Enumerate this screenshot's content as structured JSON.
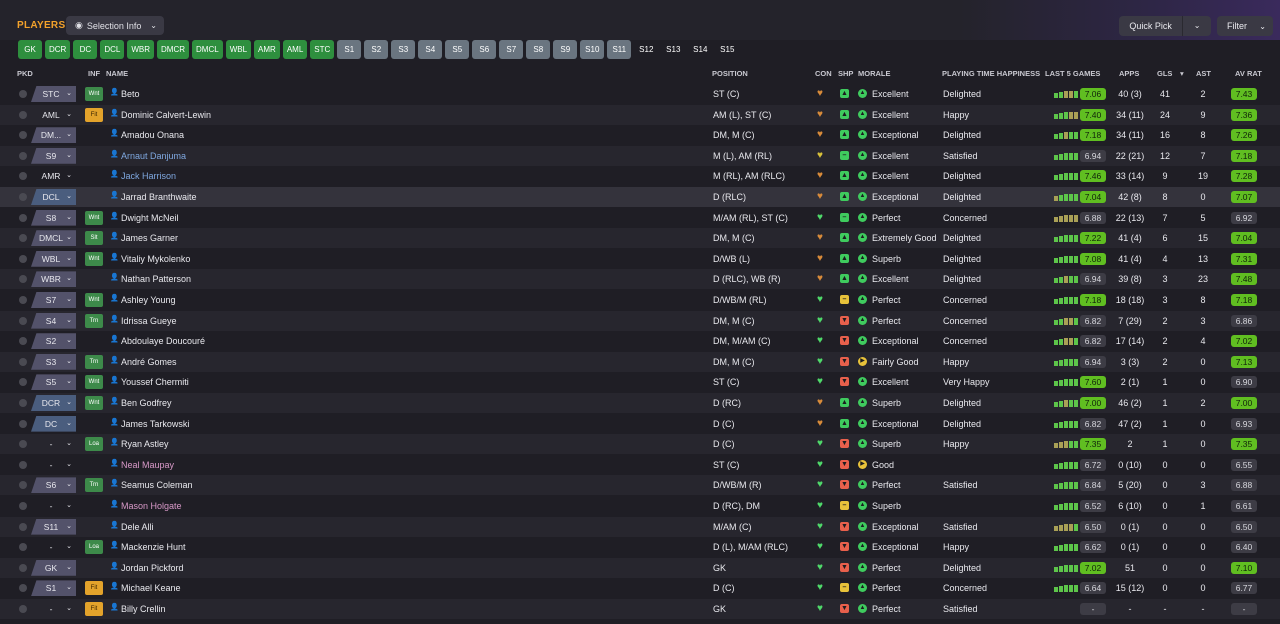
{
  "header": {
    "title": "PLAYERS",
    "selection_info": "Selection Info",
    "quick_pick": "Quick Pick",
    "filter": "Filter"
  },
  "positions": [
    {
      "label": "GK",
      "style": "g"
    },
    {
      "label": "DCR",
      "style": "g"
    },
    {
      "label": "DC",
      "style": "g"
    },
    {
      "label": "DCL",
      "style": "g"
    },
    {
      "label": "WBR",
      "style": "g"
    },
    {
      "label": "DMCR",
      "style": "g"
    },
    {
      "label": "DMCL",
      "style": "g"
    },
    {
      "label": "WBL",
      "style": "g"
    },
    {
      "label": "AMR",
      "style": "g"
    },
    {
      "label": "AML",
      "style": "g"
    },
    {
      "label": "STC",
      "style": "g"
    },
    {
      "label": "S1",
      "style": "s"
    },
    {
      "label": "S2",
      "style": "s"
    },
    {
      "label": "S3",
      "style": "s"
    },
    {
      "label": "S4",
      "style": "s"
    },
    {
      "label": "S5",
      "style": "s"
    },
    {
      "label": "S6",
      "style": "s"
    },
    {
      "label": "S7",
      "style": "s"
    },
    {
      "label": "S8",
      "style": "s"
    },
    {
      "label": "S9",
      "style": "s"
    },
    {
      "label": "S10",
      "style": "s"
    },
    {
      "label": "S11",
      "style": "s"
    },
    {
      "label": "S12",
      "style": "d"
    },
    {
      "label": "S13",
      "style": "d"
    },
    {
      "label": "S14",
      "style": "d"
    },
    {
      "label": "S15",
      "style": "d"
    }
  ],
  "columns": {
    "pkd": "PKD",
    "inf": "INF",
    "name": "NAME",
    "position": "POSITION",
    "con": "CON",
    "shp": "SHP",
    "morale": "MORALE",
    "pth": "PLAYING TIME HAPPINESS",
    "last5": "LAST 5 GAMES",
    "apps": "APPS",
    "gls": "GLS",
    "ast": "AST",
    "avrat": "AV RAT"
  },
  "colors": {
    "accent": "#f3a22b",
    "green_badge": "#60be21",
    "pos_green": "#2e8f3e",
    "pos_grey": "#6a7580"
  },
  "players": [
    {
      "role": "STC",
      "role_style": "p",
      "inf": "Wnt",
      "inf_style": "g",
      "name": "Beto",
      "name_color": "#e9e9ee",
      "position": "ST (C)",
      "con": "sad",
      "shp": "up",
      "mor": "up",
      "morale": "Excellent",
      "pth": "Delighted",
      "bars": [
        1,
        1,
        0,
        0,
        1
      ],
      "last5": "7.06",
      "last5_hi": true,
      "apps": "40 (3)",
      "gls": "41",
      "ast": "2",
      "avrat": "7.43",
      "av_hi": true
    },
    {
      "role": "AML",
      "role_style": "none",
      "inf": "Fit",
      "inf_style": "o",
      "name": "Dominic Calvert-Lewin",
      "name_color": "#e9e9ee",
      "position": "AM (L), ST (C)",
      "con": "sad",
      "shp": "up",
      "mor": "up",
      "morale": "Excellent",
      "pth": "Happy",
      "bars": [
        1,
        1,
        1,
        0,
        0
      ],
      "last5": "7.40",
      "last5_hi": true,
      "apps": "34 (11)",
      "gls": "24",
      "ast": "9",
      "avrat": "7.36",
      "av_hi": true
    },
    {
      "role": "DM...",
      "role_style": "p",
      "inf": "",
      "inf_style": "",
      "name": "Amadou Onana",
      "name_color": "#e9e9ee",
      "position": "DM, M (C)",
      "con": "sad",
      "shp": "up",
      "mor": "up",
      "morale": "Exceptional",
      "pth": "Delighted",
      "bars": [
        1,
        1,
        0,
        1,
        1
      ],
      "last5": "7.18",
      "last5_hi": true,
      "apps": "34 (11)",
      "gls": "16",
      "ast": "8",
      "avrat": "7.26",
      "av_hi": true
    },
    {
      "role": "S9",
      "role_style": "p",
      "inf": "",
      "inf_style": "",
      "name": "Arnaut Danjuma",
      "name_color": "#7fa8e0",
      "position": "M (L), AM (RL)",
      "con": "ok",
      "shp": "flat",
      "mor": "up",
      "morale": "Excellent",
      "pth": "Satisfied",
      "bars": [
        1,
        1,
        1,
        1,
        1
      ],
      "last5": "6.94",
      "last5_hi": false,
      "apps": "22 (21)",
      "gls": "12",
      "ast": "7",
      "avrat": "7.18",
      "av_hi": true
    },
    {
      "role": "AMR",
      "role_style": "none",
      "inf": "",
      "inf_style": "",
      "name": "Jack Harrison",
      "name_color": "#7fa8e0",
      "position": "M (RL), AM (RLC)",
      "con": "sad",
      "shp": "up",
      "mor": "up",
      "morale": "Excellent",
      "pth": "Delighted",
      "bars": [
        1,
        1,
        1,
        1,
        1
      ],
      "last5": "7.46",
      "last5_hi": true,
      "apps": "33 (14)",
      "gls": "9",
      "ast": "19",
      "avrat": "7.28",
      "av_hi": true
    },
    {
      "role": "DCL",
      "role_style": "blue",
      "inf": "",
      "inf_style": "",
      "name": "Jarrad Branthwaite",
      "name_color": "#e9e9ee",
      "position": "D (RLC)",
      "con": "sad",
      "shp": "up",
      "mor": "up",
      "morale": "Exceptional",
      "pth": "Delighted",
      "bars": [
        0,
        1,
        1,
        1,
        1
      ],
      "last5": "7.04",
      "last5_hi": true,
      "apps": "42 (8)",
      "gls": "8",
      "ast": "0",
      "avrat": "7.07",
      "av_hi": true
    },
    {
      "role": "S8",
      "role_style": "p",
      "inf": "Wnt",
      "inf_style": "g",
      "name": "Dwight McNeil",
      "name_color": "#e9e9ee",
      "position": "M/AM (RL), ST (C)",
      "con": "good",
      "shp": "flat",
      "mor": "up",
      "morale": "Perfect",
      "pth": "Concerned",
      "bars": [
        0,
        0,
        0,
        0,
        0
      ],
      "last5": "6.88",
      "last5_hi": false,
      "apps": "22 (13)",
      "gls": "7",
      "ast": "5",
      "avrat": "6.92",
      "av_hi": false
    },
    {
      "role": "DMCL",
      "role_style": "p",
      "inf": "Slt",
      "inf_style": "g",
      "name": "James Garner",
      "name_color": "#e9e9ee",
      "position": "DM, M (C)",
      "con": "sad",
      "shp": "up",
      "mor": "up",
      "morale": "Extremely Good",
      "pth": "Delighted",
      "bars": [
        1,
        1,
        1,
        1,
        1
      ],
      "last5": "7.22",
      "last5_hi": true,
      "apps": "41 (4)",
      "gls": "6",
      "ast": "15",
      "avrat": "7.04",
      "av_hi": true
    },
    {
      "role": "WBL",
      "role_style": "p",
      "inf": "Wnt",
      "inf_style": "g",
      "name": "Vitaliy Mykolenko",
      "name_color": "#e9e9ee",
      "position": "D/WB (L)",
      "con": "sad",
      "shp": "up",
      "mor": "up",
      "morale": "Superb",
      "pth": "Delighted",
      "bars": [
        1,
        1,
        1,
        1,
        1
      ],
      "last5": "7.08",
      "last5_hi": true,
      "apps": "41 (4)",
      "gls": "4",
      "ast": "13",
      "avrat": "7.31",
      "av_hi": true
    },
    {
      "role": "WBR",
      "role_style": "p",
      "inf": "",
      "inf_style": "",
      "name": "Nathan Patterson",
      "name_color": "#e9e9ee",
      "position": "D (RLC), WB (R)",
      "con": "sad",
      "shp": "up",
      "mor": "up",
      "morale": "Excellent",
      "pth": "Delighted",
      "bars": [
        1,
        1,
        0,
        1,
        1
      ],
      "last5": "6.94",
      "last5_hi": false,
      "apps": "39 (8)",
      "gls": "3",
      "ast": "23",
      "avrat": "7.48",
      "av_hi": true
    },
    {
      "role": "S7",
      "role_style": "p",
      "inf": "Wnt",
      "inf_style": "g",
      "name": "Ashley Young",
      "name_color": "#e9e9ee",
      "position": "D/WB/M (RL)",
      "con": "good",
      "shp": "flat2",
      "mor": "up",
      "morale": "Perfect",
      "pth": "Concerned",
      "bars": [
        1,
        1,
        1,
        1,
        1
      ],
      "last5": "7.18",
      "last5_hi": true,
      "apps": "18 (18)",
      "gls": "3",
      "ast": "8",
      "avrat": "7.18",
      "av_hi": true
    },
    {
      "role": "S4",
      "role_style": "p",
      "inf": "Trn",
      "inf_style": "g",
      "name": "Idrissa Gueye",
      "name_color": "#e9e9ee",
      "position": "DM, M (C)",
      "con": "good",
      "shp": "down",
      "mor": "up",
      "morale": "Perfect",
      "pth": "Concerned",
      "bars": [
        1,
        1,
        0,
        0,
        1
      ],
      "last5": "6.82",
      "last5_hi": false,
      "apps": "7 (29)",
      "gls": "2",
      "ast": "3",
      "avrat": "6.86",
      "av_hi": false
    },
    {
      "role": "S2",
      "role_style": "p",
      "inf": "",
      "inf_style": "",
      "name": "Abdoulaye Doucouré",
      "name_color": "#e9e9ee",
      "position": "DM, M/AM (C)",
      "con": "good",
      "shp": "down",
      "mor": "up",
      "morale": "Exceptional",
      "pth": "Concerned",
      "bars": [
        1,
        1,
        0,
        0,
        1
      ],
      "last5": "6.82",
      "last5_hi": false,
      "apps": "17 (14)",
      "gls": "2",
      "ast": "4",
      "avrat": "7.02",
      "av_hi": true
    },
    {
      "role": "S3",
      "role_style": "p",
      "inf": "Trn",
      "inf_style": "g",
      "name": "André Gomes",
      "name_color": "#e9e9ee",
      "position": "DM, M (C)",
      "con": "good",
      "shp": "down",
      "mor": "ok",
      "morale": "Fairly Good",
      "pth": "Happy",
      "bars": [
        1,
        1,
        1,
        1,
        1
      ],
      "last5": "6.94",
      "last5_hi": false,
      "apps": "3 (3)",
      "gls": "2",
      "ast": "0",
      "avrat": "7.13",
      "av_hi": true
    },
    {
      "role": "S5",
      "role_style": "p",
      "inf": "Wnt",
      "inf_style": "g",
      "name": "Youssef Chermiti",
      "name_color": "#e9e9ee",
      "position": "ST (C)",
      "con": "good",
      "shp": "down",
      "mor": "up",
      "morale": "Excellent",
      "pth": "Very Happy",
      "bars": [
        1,
        1,
        1,
        1,
        1
      ],
      "last5": "7.60",
      "last5_hi": true,
      "apps": "2 (1)",
      "gls": "1",
      "ast": "0",
      "avrat": "6.90",
      "av_hi": false
    },
    {
      "role": "DCR",
      "role_style": "blue",
      "inf": "Wnt",
      "inf_style": "g",
      "name": "Ben Godfrey",
      "name_color": "#e9e9ee",
      "position": "D (RC)",
      "con": "sad",
      "shp": "up",
      "mor": "up",
      "morale": "Superb",
      "pth": "Delighted",
      "bars": [
        1,
        1,
        0,
        1,
        1
      ],
      "last5": "7.00",
      "last5_hi": true,
      "apps": "46 (2)",
      "gls": "1",
      "ast": "2",
      "avrat": "7.00",
      "av_hi": true
    },
    {
      "role": "DC",
      "role_style": "blue",
      "inf": "",
      "inf_style": "",
      "name": "James Tarkowski",
      "name_color": "#e9e9ee",
      "position": "D (C)",
      "con": "sad",
      "shp": "up",
      "mor": "up",
      "morale": "Exceptional",
      "pth": "Delighted",
      "bars": [
        1,
        1,
        1,
        1,
        1
      ],
      "last5": "6.82",
      "last5_hi": false,
      "apps": "47 (2)",
      "gls": "1",
      "ast": "0",
      "avrat": "6.93",
      "av_hi": false
    },
    {
      "role": "-",
      "role_style": "none",
      "inf": "Loa",
      "inf_style": "g",
      "name": "Ryan Astley",
      "name_color": "#e9e9ee",
      "position": "D (C)",
      "con": "good",
      "shp": "down",
      "mor": "up",
      "morale": "Superb",
      "pth": "Happy",
      "bars": [
        0,
        0,
        0,
        1,
        1
      ],
      "last5": "7.35",
      "last5_hi": true,
      "apps": "2",
      "gls": "1",
      "ast": "0",
      "avrat": "7.35",
      "av_hi": true
    },
    {
      "role": "-",
      "role_style": "none",
      "inf": "",
      "inf_style": "",
      "name": "Neal Maupay",
      "name_color": "#d899c8",
      "position": "ST (C)",
      "con": "good",
      "shp": "down",
      "mor": "ok",
      "morale": "Good",
      "pth": "",
      "bars": [
        1,
        1,
        1,
        1,
        1
      ],
      "last5": "6.72",
      "last5_hi": false,
      "apps": "0 (10)",
      "gls": "0",
      "ast": "0",
      "avrat": "6.55",
      "av_hi": false
    },
    {
      "role": "S6",
      "role_style": "p",
      "inf": "Trn",
      "inf_style": "g",
      "name": "Seamus Coleman",
      "name_color": "#e9e9ee",
      "position": "D/WB/M (R)",
      "con": "good",
      "shp": "down",
      "mor": "up",
      "morale": "Perfect",
      "pth": "Satisfied",
      "bars": [
        1,
        1,
        1,
        1,
        1
      ],
      "last5": "6.84",
      "last5_hi": false,
      "apps": "5 (20)",
      "gls": "0",
      "ast": "3",
      "avrat": "6.88",
      "av_hi": false
    },
    {
      "role": "-",
      "role_style": "none",
      "inf": "",
      "inf_style": "",
      "name": "Mason Holgate",
      "name_color": "#d899c8",
      "position": "D (RC), DM",
      "con": "good",
      "shp": "flat2",
      "mor": "up",
      "morale": "Superb",
      "pth": "",
      "bars": [
        1,
        1,
        1,
        1,
        1
      ],
      "last5": "6.52",
      "last5_hi": false,
      "apps": "6 (10)",
      "gls": "0",
      "ast": "1",
      "avrat": "6.61",
      "av_hi": false
    },
    {
      "role": "S11",
      "role_style": "p",
      "inf": "",
      "inf_style": "",
      "name": "Dele Alli",
      "name_color": "#e9e9ee",
      "position": "M/AM (C)",
      "con": "good",
      "shp": "down",
      "mor": "up",
      "morale": "Exceptional",
      "pth": "Satisfied",
      "bars": [
        0,
        0,
        0,
        0,
        1
      ],
      "last5": "6.50",
      "last5_hi": false,
      "apps": "0 (1)",
      "gls": "0",
      "ast": "0",
      "avrat": "6.50",
      "av_hi": false
    },
    {
      "role": "-",
      "role_style": "none",
      "inf": "Loa",
      "inf_style": "g",
      "name": "Mackenzie Hunt",
      "name_color": "#e9e9ee",
      "position": "D (L), M/AM (RLC)",
      "con": "good",
      "shp": "down",
      "mor": "up",
      "morale": "Exceptional",
      "pth": "Happy",
      "bars": [
        1,
        1,
        1,
        1,
        1
      ],
      "last5": "6.62",
      "last5_hi": false,
      "apps": "0 (1)",
      "gls": "0",
      "ast": "0",
      "avrat": "6.40",
      "av_hi": false
    },
    {
      "role": "GK",
      "role_style": "p",
      "inf": "",
      "inf_style": "",
      "name": "Jordan Pickford",
      "name_color": "#e9e9ee",
      "position": "GK",
      "con": "good",
      "shp": "down",
      "mor": "up",
      "morale": "Perfect",
      "pth": "Delighted",
      "bars": [
        1,
        1,
        1,
        1,
        1
      ],
      "last5": "7.02",
      "last5_hi": true,
      "apps": "51",
      "gls": "0",
      "ast": "0",
      "avrat": "7.10",
      "av_hi": true
    },
    {
      "role": "S1",
      "role_style": "p",
      "inf": "Fit",
      "inf_style": "o",
      "name": "Michael Keane",
      "name_color": "#e9e9ee",
      "position": "D (C)",
      "con": "good",
      "shp": "flat2",
      "mor": "up",
      "morale": "Perfect",
      "pth": "Concerned",
      "bars": [
        1,
        1,
        1,
        1,
        1
      ],
      "last5": "6.64",
      "last5_hi": false,
      "apps": "15 (12)",
      "gls": "0",
      "ast": "0",
      "avrat": "6.77",
      "av_hi": false
    },
    {
      "role": "-",
      "role_style": "none",
      "inf": "Fit",
      "inf_style": "o",
      "name": "Billy Crellin",
      "name_color": "#e9e9ee",
      "position": "GK",
      "con": "good",
      "shp": "down",
      "mor": "up",
      "morale": "Perfect",
      "pth": "Satisfied",
      "bars": [],
      "last5": "-",
      "last5_hi": false,
      "apps": "-",
      "gls": "-",
      "ast": "-",
      "avrat": "-",
      "av_hi": false
    }
  ]
}
